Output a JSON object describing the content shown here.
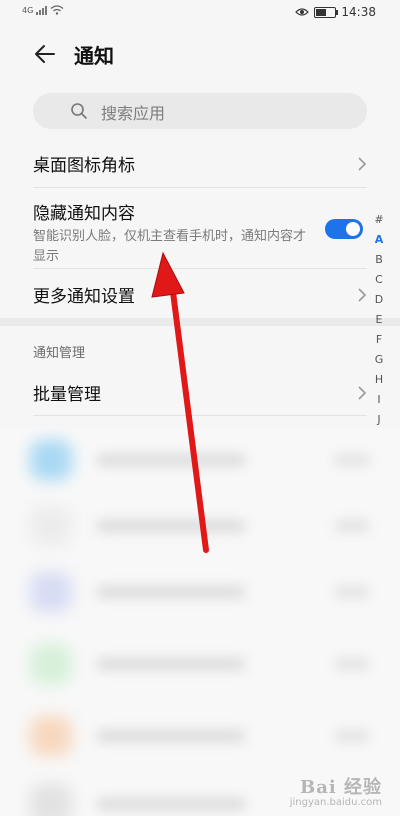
{
  "status_bar": {
    "network": "4G",
    "time": "14:38",
    "battery_level": 0.55
  },
  "header": {
    "title": "通知"
  },
  "search": {
    "placeholder": "搜索应用"
  },
  "settings": {
    "desktop_badge": {
      "label": "桌面图标角标"
    },
    "hide_content": {
      "label": "隐藏通知内容",
      "description": "智能识别人脸，仅机主查看手机时，通知内容才显示",
      "enabled": true
    },
    "more_settings": {
      "label": "更多通知设置"
    }
  },
  "management": {
    "section_header": "通知管理",
    "batch_label": "批量管理"
  },
  "index_bar": {
    "letters": [
      "#",
      "A",
      "B",
      "C",
      "D",
      "E",
      "F",
      "G",
      "H",
      "I",
      "J"
    ],
    "active": "A"
  },
  "annotation": {
    "arrow_color": "#e01818"
  },
  "watermark": {
    "main": "Bai 经验",
    "sub": "jingyan.baidu.com"
  },
  "colors": {
    "accent": "#1f73e8",
    "background": "#f6f6f6"
  }
}
